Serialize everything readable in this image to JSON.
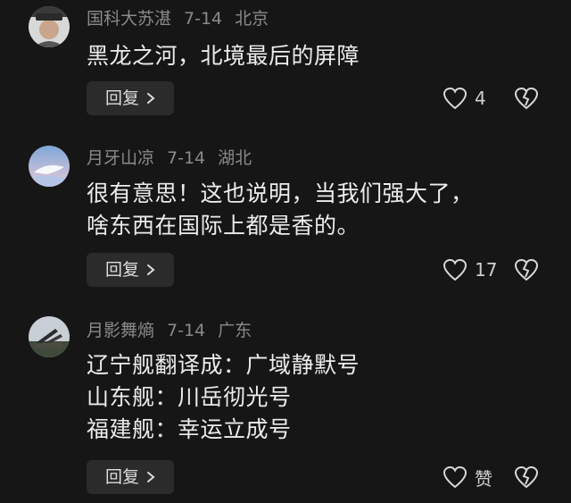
{
  "comments": [
    {
      "username": "国科大苏湛",
      "date": "7-14",
      "location": "北京",
      "lines": [
        "黑龙之河，北境最后的屏障"
      ],
      "reply_label": "回复",
      "like_count": "4"
    },
    {
      "username": "月牙山凉",
      "date": "7-14",
      "location": "湖北",
      "lines": [
        "很有意思！这也说明，当我们强大了，",
        "啥东西在国际上都是香的。"
      ],
      "reply_label": "回复",
      "like_count": "17"
    },
    {
      "username": "月影舞熵",
      "date": "7-14",
      "location": "广东",
      "lines": [
        "辽宁舰翻译成：广域静默号",
        "山东舰：川岳彻光号",
        "福建舰：幸运立成号"
      ],
      "reply_label": "回复",
      "like_count": "赞"
    }
  ],
  "icons": {
    "like": "heart-outline-icon",
    "dislike": "broken-heart-icon",
    "reply_chevron": "chevron-right-icon"
  },
  "colors": {
    "background": "#161616",
    "meta_text": "#8a8a8a",
    "body_text": "#ececec",
    "reply_button_bg": "#2b2b2b"
  }
}
